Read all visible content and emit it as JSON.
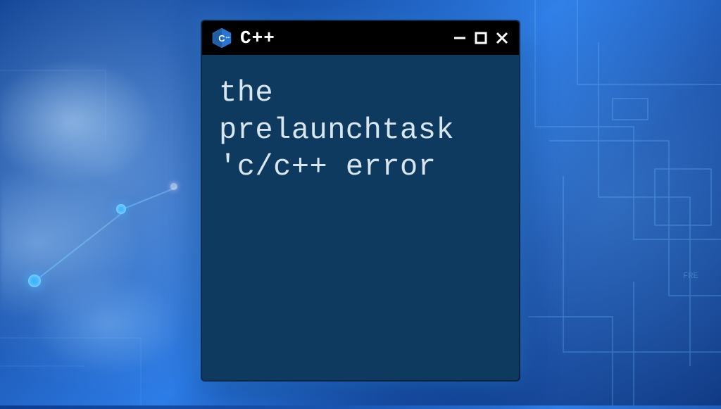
{
  "window": {
    "icon_name": "cpp-logo-icon",
    "title": "C++",
    "controls": {
      "minimize": "−",
      "maximize": "☐",
      "close": "×"
    }
  },
  "terminal": {
    "content": "the\nprelaunchtask\n'c/c++ error"
  },
  "colors": {
    "window_bg": "#0f3a5f",
    "titlebar_bg": "#000000",
    "text": "#d8e6f0",
    "accent_blue": "#3fb5ff",
    "cpp_hex": "#1e5fa8"
  }
}
